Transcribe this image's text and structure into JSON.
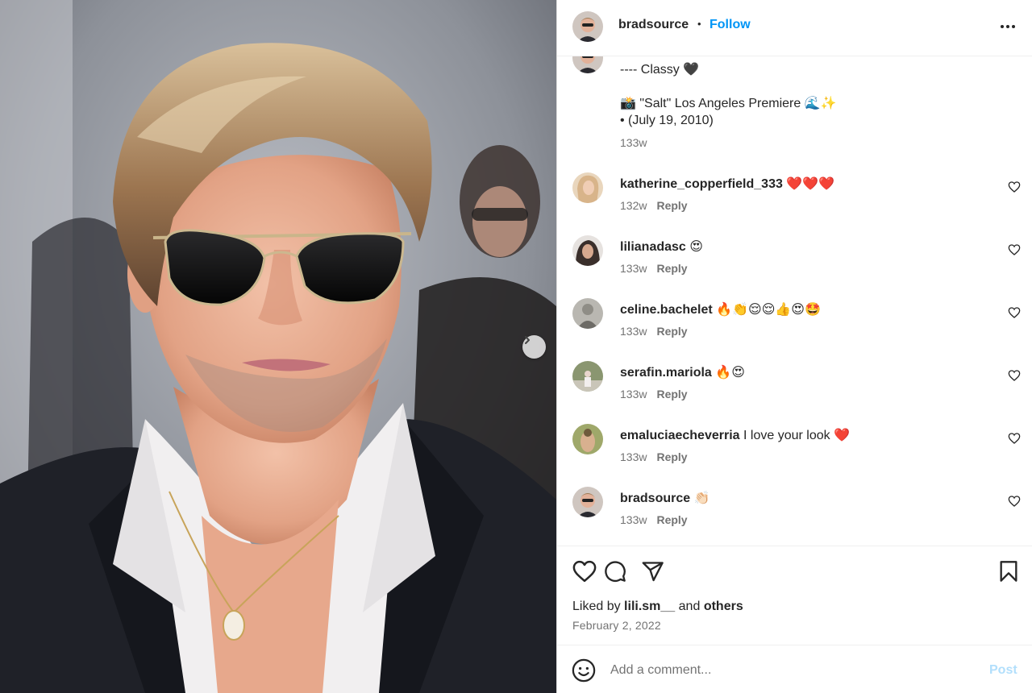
{
  "header": {
    "username": "bradsource",
    "separator": "•",
    "follow_label": "Follow",
    "more_icon": "more-horizontal-icon"
  },
  "caption": {
    "text": "---- Classy 🖤\n\n📸 \"Salt\" Los Angeles Premiere 🌊✨\n• (July 19, 2010)",
    "time": "133w"
  },
  "comments": [
    {
      "username": "katherine_copperfield_333",
      "text": "❤️❤️❤️",
      "time": "132w",
      "reply": "Reply",
      "avatar_color": "#d8b48a"
    },
    {
      "username": "lilianadasc",
      "text": "😍",
      "time": "133w",
      "reply": "Reply",
      "avatar_color": "#5a4a44"
    },
    {
      "username": "celine.bachelet",
      "text": "🔥👏😌😌👍😍🤩",
      "time": "133w",
      "reply": "Reply",
      "avatar_color": "#8f8d86"
    },
    {
      "username": "serafin.mariola",
      "text": "🔥😍",
      "time": "133w",
      "reply": "Reply",
      "avatar_color": "#6e7b5a"
    },
    {
      "username": "emaluciaecheverria",
      "text": "I love your look ❤️",
      "time": "133w",
      "reply": "Reply",
      "avatar_color": "#9a9a58"
    },
    {
      "username": "bradsource",
      "text": "👏🏻",
      "time": "133w",
      "reply": "Reply",
      "avatar_color": "#c9a58e"
    }
  ],
  "actions": {
    "like_icon": "heart-icon",
    "comment_icon": "comment-icon",
    "share_icon": "send-icon",
    "save_icon": "bookmark-icon",
    "liked_prefix": "Liked by",
    "liked_user": "lili.sm__",
    "liked_and": "and",
    "liked_others": "others",
    "date": "February 2, 2022"
  },
  "composer": {
    "placeholder": "Add a comment...",
    "post_label": "Post",
    "emoji_icon": "smiley-icon"
  },
  "colors": {
    "accent": "#0095f6",
    "post_disabled": "#b2dffc",
    "muted": "#737373"
  }
}
